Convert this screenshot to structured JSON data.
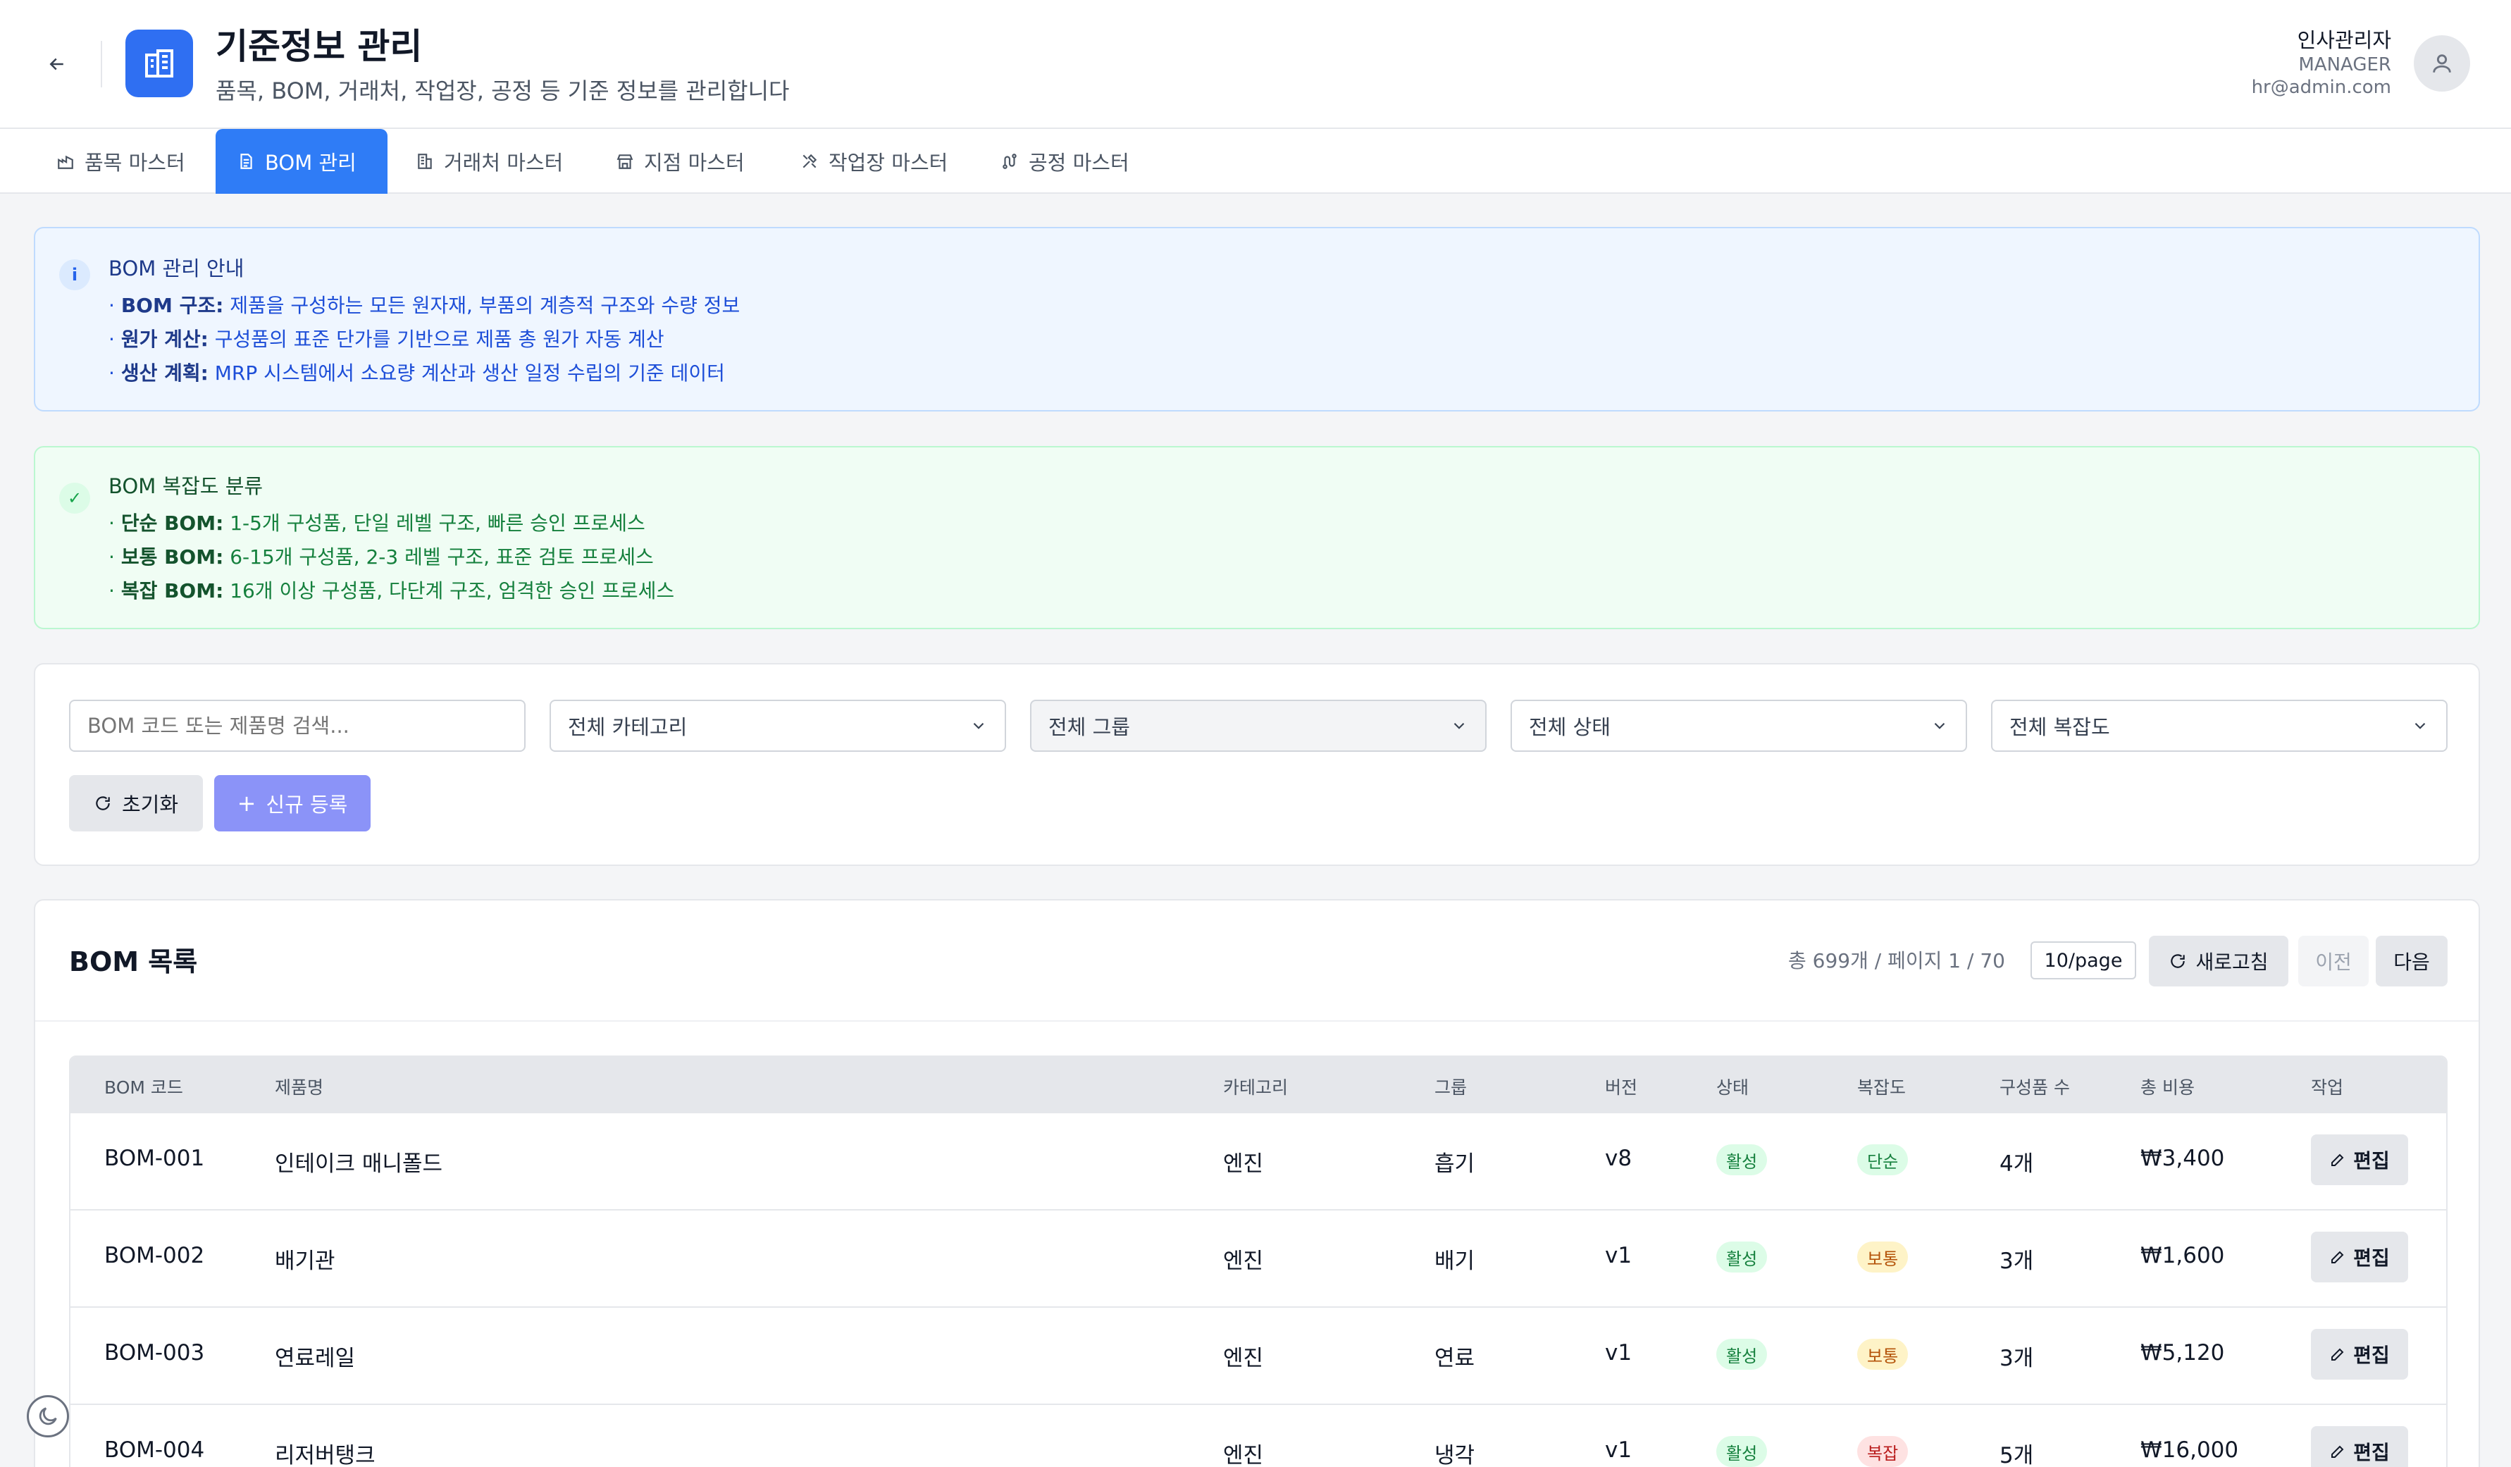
{
  "header": {
    "title": "기준정보 관리",
    "subtitle": "품목, BOM, 거래처, 작업장, 공정 등 기준 정보를 관리합니다",
    "back_icon": "arrow-left-icon",
    "app_icon": "building-icon",
    "user": {
      "name": "인사관리자",
      "role": "MANAGER",
      "email": "hr@admin.com"
    }
  },
  "tabs": [
    {
      "label": "품목 마스터",
      "icon": "factory-icon",
      "active": false
    },
    {
      "label": "BOM 관리",
      "icon": "document-list-icon",
      "active": true
    },
    {
      "label": "거래처 마스터",
      "icon": "building-icon",
      "active": false
    },
    {
      "label": "지점 마스터",
      "icon": "store-icon",
      "active": false
    },
    {
      "label": "작업장 마스터",
      "icon": "tools-icon",
      "active": false
    },
    {
      "label": "공정 마스터",
      "icon": "route-icon",
      "active": false
    }
  ],
  "info_notice": {
    "title": "BOM 관리 안내",
    "lines": [
      {
        "label": "BOM 구조:",
        "text": "제품을 구성하는 모든 원자재, 부품의 계층적 구조와 수량 정보"
      },
      {
        "label": "원가 계산:",
        "text": "구성품의 표준 단가를 기반으로 제품 총 원가 자동 계산"
      },
      {
        "label": "생산 계획:",
        "text": "MRP 시스템에서 소요량 계산과 생산 일정 수립의 기준 데이터"
      }
    ]
  },
  "complexity_notice": {
    "title": "BOM 복잡도 분류",
    "lines": [
      {
        "label": "단순 BOM:",
        "text": "1-5개 구성품, 단일 레벨 구조, 빠른 승인 프로세스"
      },
      {
        "label": "보통 BOM:",
        "text": "6-15개 구성품, 2-3 레벨 구조, 표준 검토 프로세스"
      },
      {
        "label": "복잡 BOM:",
        "text": "16개 이상 구성품, 다단계 구조, 엄격한 승인 프로세스"
      }
    ]
  },
  "filters": {
    "search_placeholder": "BOM 코드 또는 제품명 검색...",
    "category": "전체 카테고리",
    "group": "전체 그룹",
    "status": "전체 상태",
    "complexity": "전체 복잡도",
    "reset_label": "초기화",
    "new_label": "신규 등록"
  },
  "list": {
    "title": "BOM 목록",
    "meta": "총 699개 / 페이지 1 / 70",
    "per_page": "10/page",
    "refresh_label": "새로고침",
    "prev_label": "이전",
    "next_label": "다음",
    "columns": [
      "BOM 코드",
      "제품명",
      "카테고리",
      "그룹",
      "버전",
      "상태",
      "복잡도",
      "구성품 수",
      "총 비용",
      "작업"
    ],
    "rows": [
      {
        "code": "BOM-001",
        "name": "인테이크 매니폴드",
        "category": "엔진",
        "group": "흡기",
        "version": "v8",
        "status": "활성",
        "complexity": "단순",
        "complexity_kind": "simple",
        "components": "4개",
        "cost": "₩3,400",
        "action": "편집"
      },
      {
        "code": "BOM-002",
        "name": "배기관",
        "category": "엔진",
        "group": "배기",
        "version": "v1",
        "status": "활성",
        "complexity": "보통",
        "complexity_kind": "normal",
        "components": "3개",
        "cost": "₩1,600",
        "action": "편집"
      },
      {
        "code": "BOM-003",
        "name": "연료레일",
        "category": "엔진",
        "group": "연료",
        "version": "v1",
        "status": "활성",
        "complexity": "보통",
        "complexity_kind": "normal",
        "components": "3개",
        "cost": "₩5,120",
        "action": "편집"
      },
      {
        "code": "BOM-004",
        "name": "리저버탱크",
        "category": "엔진",
        "group": "냉각",
        "version": "v1",
        "status": "활성",
        "complexity": "복잡",
        "complexity_kind": "complex",
        "components": "5개",
        "cost": "₩16,000",
        "action": "편집"
      }
    ]
  },
  "colors": {
    "accent": "#2f7cf6",
    "new_button": "#8b93f8",
    "info_bg": "#eff6ff",
    "success_bg": "#f0fdf4"
  }
}
